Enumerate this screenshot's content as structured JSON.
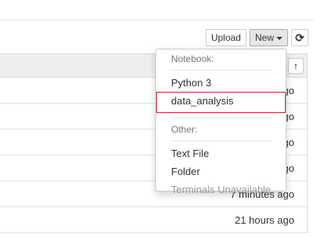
{
  "toolbar": {
    "upload_label": "Upload",
    "new_label": "New",
    "refresh_glyph": "⟳"
  },
  "list": {
    "sort_glyph": "↑",
    "rows": [
      {
        "modified": "ago"
      },
      {
        "modified": "go"
      },
      {
        "modified": "go"
      },
      {
        "modified": "go"
      },
      {
        "modified": "7 minutes ago"
      },
      {
        "modified": "21 hours ago"
      }
    ]
  },
  "new_menu": {
    "notebook_header": "Notebook:",
    "python3": "Python 3",
    "data_analysis": "data_analysis",
    "other_header": "Other:",
    "text_file": "Text File",
    "folder": "Folder",
    "terminals": "Terminals Unavailable"
  },
  "colors": {
    "selected_outline": "#c0272d",
    "header_bg": "#eeeeee"
  }
}
